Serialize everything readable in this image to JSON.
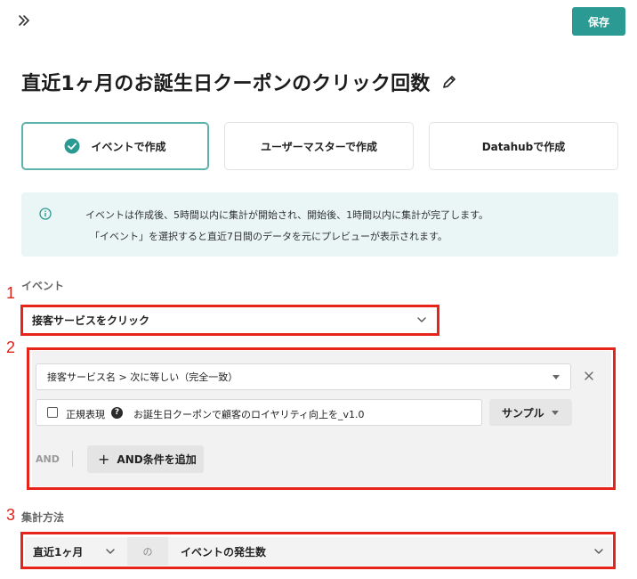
{
  "header": {
    "save_label": "保存",
    "expand_icon": "double-chevron-right-icon"
  },
  "title": {
    "text": "直近1ヶ月のお誕生日クーポンのクリック回数",
    "edit_icon": "pencil-icon"
  },
  "creation_modes": [
    {
      "label": "イベントで作成",
      "selected": true
    },
    {
      "label": "ユーザーマスターで作成",
      "selected": false
    },
    {
      "label": "Datahubで作成",
      "selected": false
    }
  ],
  "info": {
    "icon": "info-icon",
    "line1": "イベントは作成後、5時間以内に集計が開始され、開始後、1時間以内に集計が完了します。",
    "line2": "「イベント」を選択すると直近7日間のデータを元にプレビューが表示されます。"
  },
  "markers": {
    "m1": "1",
    "m2": "2",
    "m3": "3"
  },
  "event_section": {
    "label": "イベント",
    "selected_event": "接客サービスをクリック"
  },
  "condition": {
    "filter": "接客サービス名 > 次に等しい（完全一致）",
    "regex_label": "正規表現",
    "help_glyph": "?",
    "value": "お誕生日クーポンで顧客のロイヤリティ向上を_v1.0",
    "sample_label": "サンプル",
    "and_label": "AND",
    "add_condition_label": "AND条件を追加",
    "plus_glyph": "+"
  },
  "aggregation": {
    "label": "集計方法",
    "period": "直近1ヶ月",
    "connector": "の",
    "metric": "イベントの発生数"
  },
  "colors": {
    "accent": "#2b9a92",
    "highlight_frame": "#e8231a",
    "info_bg": "#eaf6f6"
  }
}
